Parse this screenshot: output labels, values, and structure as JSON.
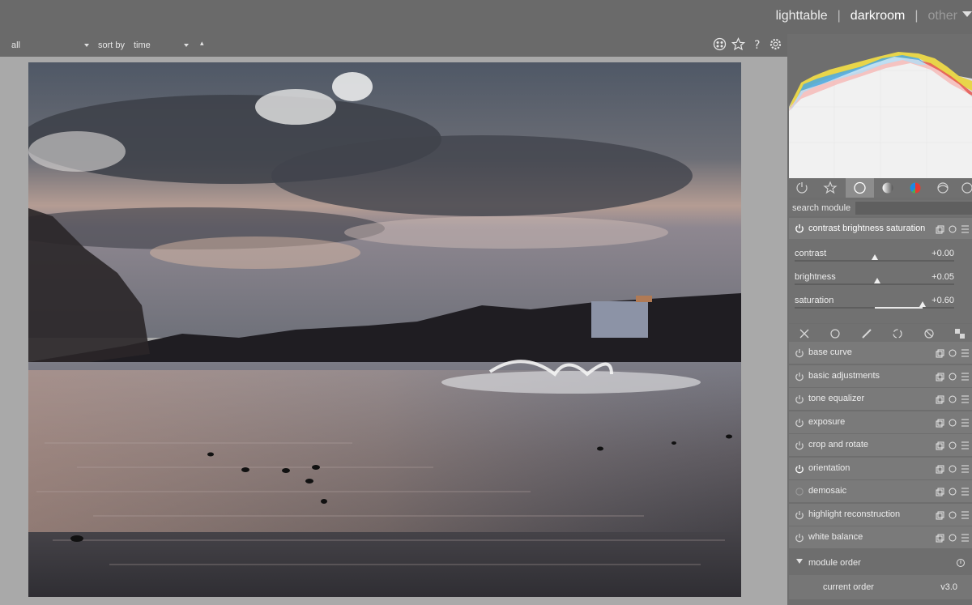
{
  "header": {
    "views": [
      "lighttable",
      "darkroom",
      "other"
    ],
    "separator": "|"
  },
  "filterbar": {
    "filter_value": "all",
    "sort_label": "sort by",
    "sort_value": "time",
    "sort_order_glyph": "▴",
    "tools": [
      "color-grid-icon",
      "star-icon",
      "help-icon",
      "gear-icon"
    ]
  },
  "right_panel": {
    "tabs": [
      "power-icon",
      "star-icon",
      "circle-icon",
      "gradient-circle-icon",
      "color-circle-icon",
      "loop-icon",
      "checker-icon"
    ],
    "search": {
      "label": "search module",
      "placeholder": ""
    },
    "module": {
      "title": "contrast brightness saturation",
      "sliders": [
        {
          "name": "contrast",
          "value": "+0.00",
          "position": 0.5
        },
        {
          "name": "brightness",
          "value": "+0.05",
          "position": 0.52
        },
        {
          "name": "saturation",
          "value": "+0.60",
          "position": 0.8
        }
      ]
    },
    "module_groups": [
      "close-icon",
      "circle-icon",
      "pencil-icon",
      "effects-icon",
      "correct-icon",
      "checker-icon"
    ],
    "modules": [
      {
        "label": "base curve",
        "enabled": false
      },
      {
        "label": "basic adjustments",
        "enabled": false
      },
      {
        "label": "tone equalizer",
        "enabled": false
      },
      {
        "label": "exposure",
        "enabled": false
      },
      {
        "label": "crop and rotate",
        "enabled": false
      },
      {
        "label": "orientation",
        "enabled": true
      },
      {
        "label": "demosaic",
        "enabled": false
      },
      {
        "label": "highlight reconstruction",
        "enabled": false
      },
      {
        "label": "white balance",
        "enabled": false
      }
    ],
    "module_order": {
      "title": "module order",
      "current_label": "current order",
      "current_value": "v3.0"
    }
  }
}
